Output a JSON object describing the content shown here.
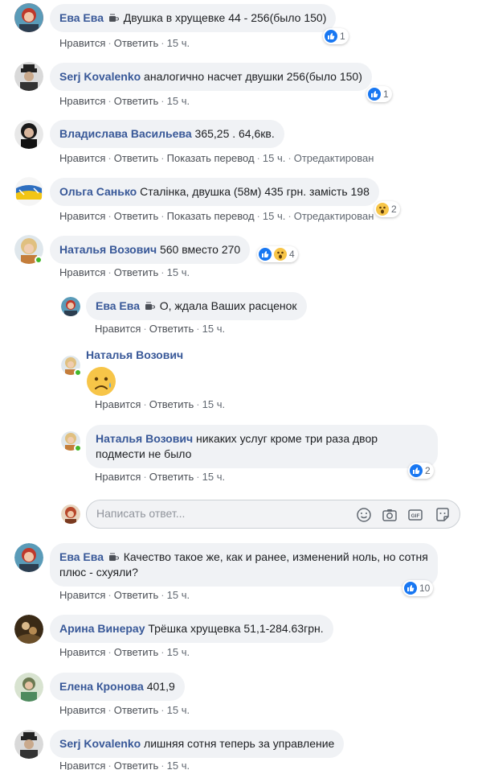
{
  "actions": {
    "like": "Нравится",
    "reply": "Ответить",
    "translate": "Показать перевод",
    "edited": "Отредактирован",
    "time": "15 ч."
  },
  "comments": [
    {
      "author": "Ева Ева",
      "text": "Двушка в хрущевке 44 - 256(было 150)",
      "reactions": "1"
    },
    {
      "author": "Serj Kovalenko",
      "text": "аналогично насчет двушки 256(было 150)",
      "reactions": "1"
    },
    {
      "author": "Владислава Васильева",
      "text": "365,25 . 64,6кв."
    },
    {
      "author": "Ольга Санько",
      "text": "Сталінка, двушка (58м) 435 грн. замість 198",
      "reactions": "2"
    },
    {
      "author": "Наталья Возович",
      "text": "560 вместо 270",
      "reactions": "4"
    },
    {
      "author": "Ева Ева",
      "text": "Качество такое же, как и ранее, изменений ноль, но сотня плюс - схуяли?",
      "reactions": "10"
    },
    {
      "author": "Арина Винерау",
      "text": "Трёшка хрущевка 51,1-284.63грн."
    },
    {
      "author": "Елена Кронова",
      "text": "401,9"
    },
    {
      "author": "Serj Kovalenko",
      "text": "лишняя сотня теперь за управление"
    }
  ],
  "replies": [
    {
      "author": "Ева Ева",
      "text": "О, ждала Ваших расценок"
    },
    {
      "author": "Наталья Возович",
      "sticker": "sad-face-emoji"
    },
    {
      "author": "Наталья Возович",
      "text": "никаких услуг кроме три раза двор подмести не было",
      "reactions": "2"
    }
  ],
  "reply_box": {
    "placeholder": "Написать ответ..."
  },
  "colors": {
    "author": "#385898",
    "like": "#1877f2",
    "bubble": "#f0f2f5"
  }
}
